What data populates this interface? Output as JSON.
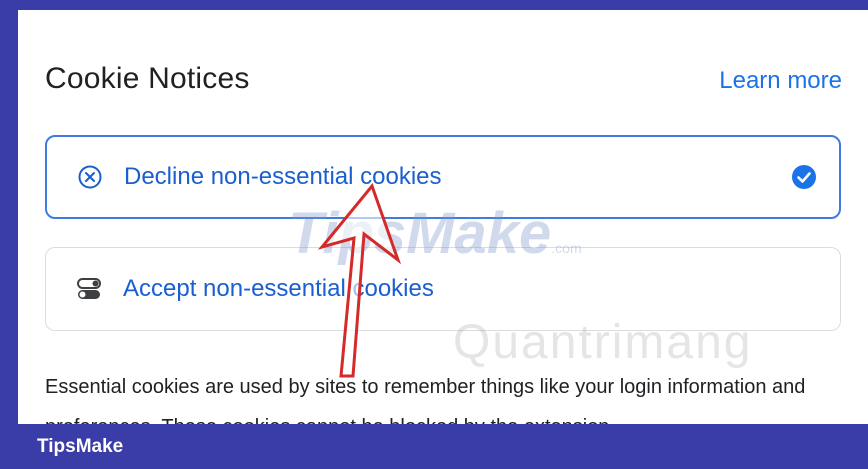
{
  "header": {
    "title": "Cookie Notices",
    "learn_more": "Learn more"
  },
  "options": [
    {
      "label": "Decline non-essential cookies",
      "icon": "cancel-circle-icon",
      "selected": true
    },
    {
      "label": "Accept non-essential cookies",
      "icon": "toggle-icon",
      "selected": false
    }
  ],
  "description": "Essential cookies are used by sites to remember things like your login information and preferences. These cookies cannot be blocked by the extension",
  "watermark": {
    "brand": "TipsMake",
    "suffix": ".com",
    "secondary": "Quantrimang"
  },
  "footer": {
    "brand": "TipsMake"
  },
  "colors": {
    "accent": "#1a73e8",
    "selected_border": "#3f7be0",
    "frame": "#3a3ca8",
    "annotation_arrow": "#d42a2a"
  }
}
